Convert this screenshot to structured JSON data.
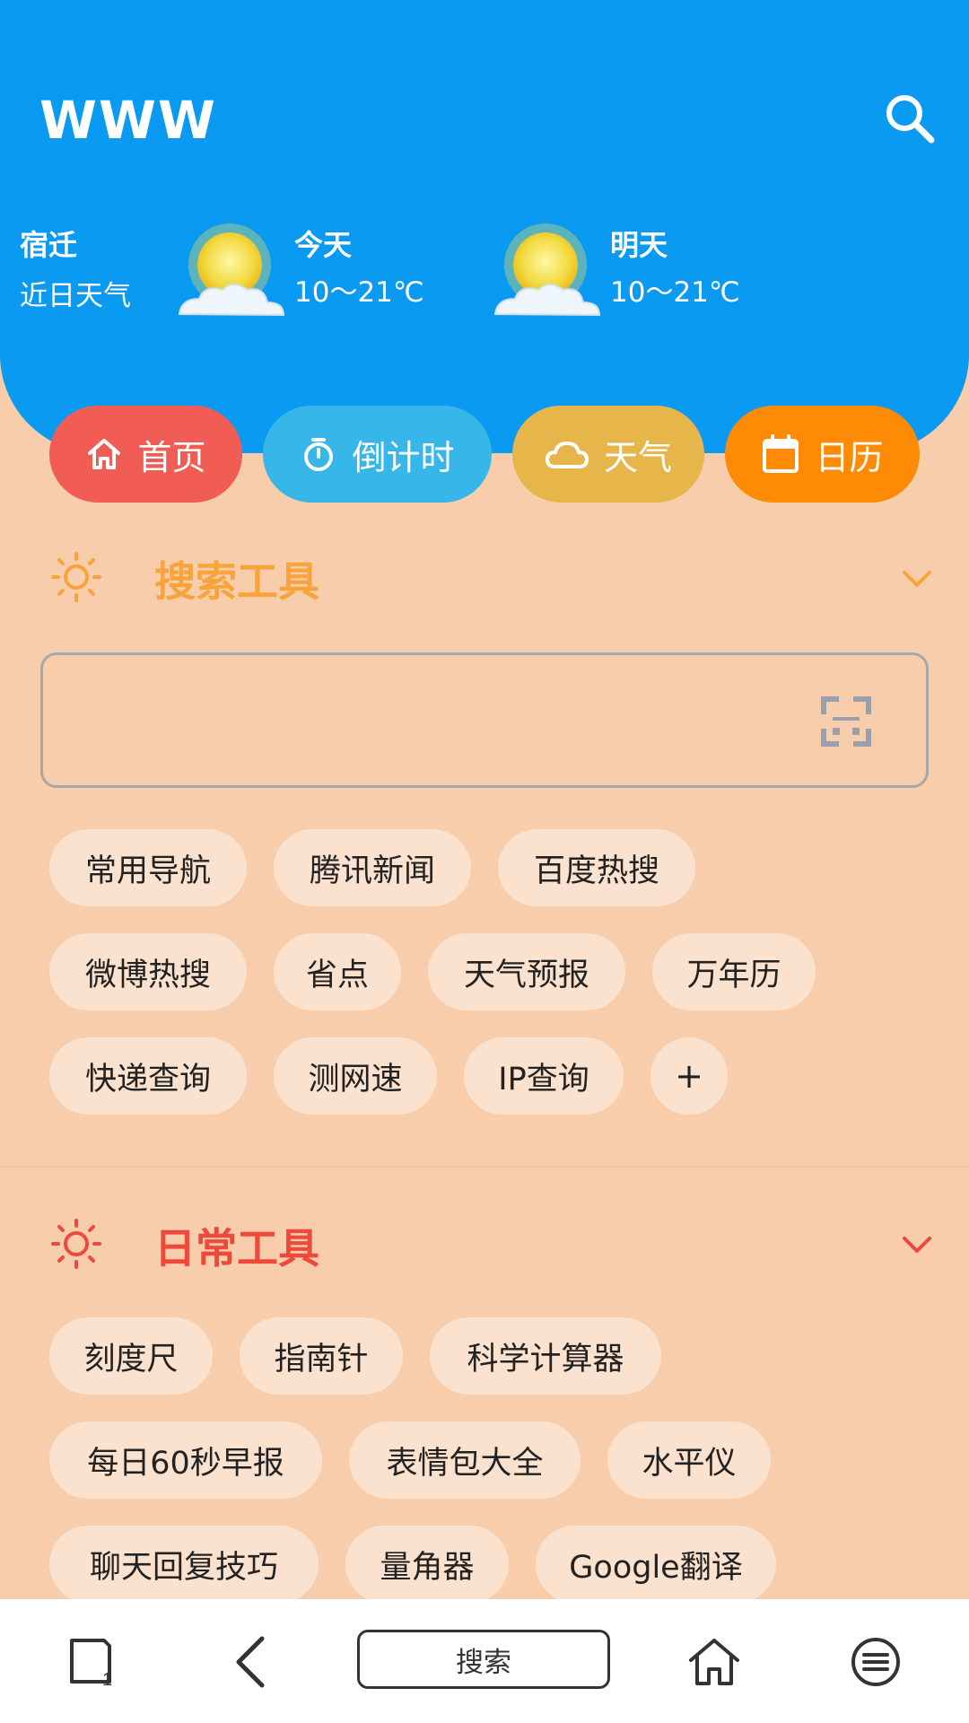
{
  "header": {
    "app_title": "WWW",
    "city": "宿迁",
    "recent_label": "近日天气",
    "today": {
      "title": "今天",
      "temp": "10～21℃"
    },
    "tomorrow": {
      "title": "明天",
      "temp": "10～21℃"
    }
  },
  "nav": [
    {
      "label": "首页",
      "icon": "home-icon",
      "color": "#f15c55"
    },
    {
      "label": "倒计时",
      "icon": "timer-icon",
      "color": "#36b6e9"
    },
    {
      "label": "天气",
      "icon": "cloud-icon",
      "color": "#e6b64a"
    },
    {
      "label": "日历",
      "icon": "calendar-icon",
      "color": "#ff8a06"
    }
  ],
  "search_tools": {
    "title": "搜索工具",
    "color": "#f8a43a",
    "input_value": "",
    "chips": [
      "常用导航",
      "腾讯新闻",
      "百度热搜",
      "微博热搜",
      "省点",
      "天气预报",
      "万年历",
      "快递查询",
      "测网速",
      "IP查询",
      "+"
    ]
  },
  "daily_tools": {
    "title": "日常工具",
    "color": "#ee4a3c",
    "chips": [
      "刻度尺",
      "指南针",
      "科学计算器",
      "每日60秒早报",
      "表情包大全",
      "水平仪",
      "聊天回复技巧",
      "量角器",
      "Google翻译"
    ]
  },
  "bottom_bar": {
    "search_label": "搜索",
    "tabs_count": "1"
  }
}
